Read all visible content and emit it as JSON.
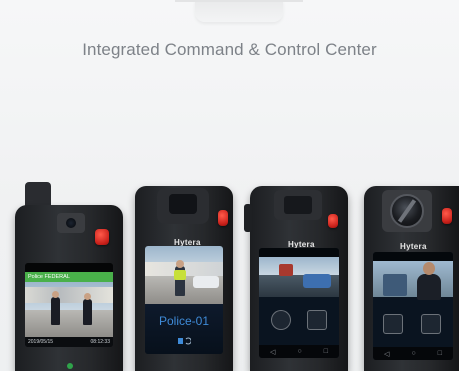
{
  "header": {
    "title": "Integrated Command & Control Center"
  },
  "devices": [
    {
      "banner": "Police FEDERAL",
      "date": "2019/05/15",
      "time": "08:12:33"
    },
    {
      "brand": "Hytera",
      "caption": "Police-01"
    },
    {
      "brand": "Hytera"
    },
    {
      "brand": "Hytera"
    }
  ],
  "colors": {
    "accent_red": "#d8281e",
    "banner_green": "#49b04a",
    "caption_blue": "#3f8bd8"
  }
}
